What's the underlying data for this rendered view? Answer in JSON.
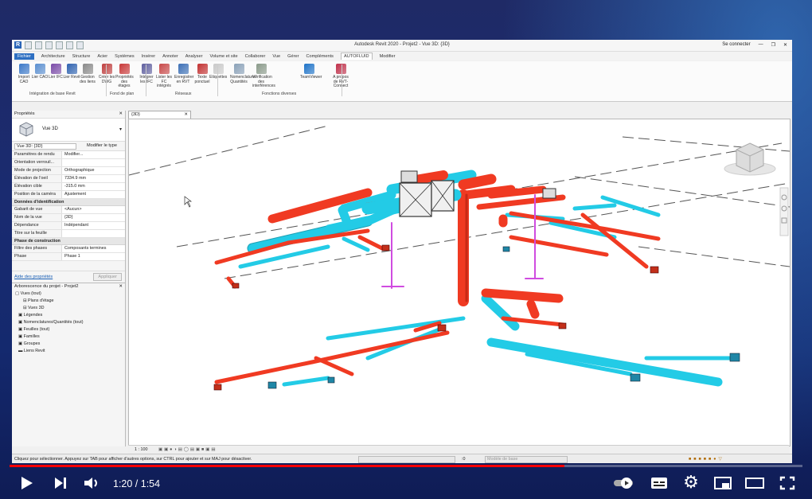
{
  "revit": {
    "window_title": "Autodesk Revit 2020 - Projet2 - Vue 3D: {3D}",
    "sign_in": "Se connecter",
    "tabs": [
      "Fichier",
      "Architecture",
      "Structure",
      "Acier",
      "Systèmes",
      "Insérer",
      "Annoter",
      "Analyser",
      "Volume et site",
      "Collaborer",
      "Vue",
      "Gérer",
      "Compléments",
      "AUTOFLUID",
      "Modifier"
    ],
    "ribbon": {
      "buttons": [
        {
          "label": "Import CAO",
          "color": "#3a78c8"
        },
        {
          "label": "Lier CAO",
          "color": "#5a8fd0"
        },
        {
          "label": "Lier IFC",
          "color": "#7a4aa8"
        },
        {
          "label": "Lier Revit",
          "color": "#2e62b0"
        },
        {
          "label": "Gestion des liens",
          "color": "#8a8a8a"
        },
        {
          "label": "Créer les DWG",
          "color": "#c04040"
        },
        {
          "label": "Propriétés des étages",
          "color": "#c83838"
        },
        {
          "label": "Intégrer les IFC",
          "color": "#5f5f9f"
        },
        {
          "label": "Lister les FC intégrés",
          "color": "#c84848"
        },
        {
          "label": "Enregistrer en RVT",
          "color": "#3b6fb6"
        },
        {
          "label": "Texte ponctuel",
          "color": "#c23030"
        },
        {
          "label": "Etiquettes",
          "color": "#c9c9c9"
        },
        {
          "label": "Nomenclature/ Quantités",
          "color": "#8aa1b8"
        },
        {
          "label": "Vérification des interférences",
          "color": "#8a9a8a"
        },
        {
          "label": "TeamViewer",
          "color": "#1e73c8"
        },
        {
          "label": "A propos de RVT-Connect",
          "color": "#c0304a"
        }
      ],
      "groups": [
        "Intégration de base Revit",
        "Fond de plan",
        "Réseaux",
        "Fonctions diverses"
      ]
    },
    "properties": {
      "header": "Propriétés",
      "type_name": "Vue 3D",
      "selector": "Vue 3D: {3D}",
      "edit_type": "Modifier le type",
      "rows": [
        {
          "k": "Paramètres de rendu",
          "v": "Modifier..."
        },
        {
          "k": "Orientation verrouil...",
          "v": ""
        },
        {
          "k": "Mode de projection",
          "v": "Orthographique"
        },
        {
          "k": "Élévation de l'oeil",
          "v": "7334.9 mm"
        },
        {
          "k": "Élévation cible",
          "v": "-315.0 mm"
        },
        {
          "k": "Position de la caméra",
          "v": "Ajustement"
        }
      ],
      "section_ident": "Données d'identification",
      "rows2": [
        {
          "k": "Gabarit de vue",
          "v": "<Aucun>"
        },
        {
          "k": "Nom de la vue",
          "v": "{3D}"
        },
        {
          "k": "Dépendance",
          "v": "Indépendant"
        },
        {
          "k": "Titre sur la feuille",
          "v": ""
        }
      ],
      "section_phase": "Phase de construction",
      "rows3": [
        {
          "k": "Filtre des phases",
          "v": "Composants termines"
        },
        {
          "k": "Phase",
          "v": "Phase 1"
        }
      ],
      "help_link": "Aide des propriétés",
      "apply": "Appliquer"
    },
    "browser": {
      "header": "Arborescence du projet - Projet2",
      "items": [
        "Vues (tout)",
        "Plans d'étage",
        "Vues 3D",
        "Légendes",
        "Nomenclatures/Quantités (tout)",
        "Feuilles (tout)",
        "Familles",
        "Groupes",
        "Liens Revit"
      ]
    },
    "view_tab": "{3D}",
    "scale": "1 : 100",
    "status_text": "Cliquez pour sélectionner. Appuyez sur TAB pour afficher d'autres options, sur CTRL pour ajouter et sur MAJ pour désactiver.",
    "status_model": "Modèle de base",
    "status_zero": ":0"
  },
  "player": {
    "time": "1:20 / 1:54",
    "progress": 0.7
  },
  "colors": {
    "supply": "#f03a22",
    "return": "#23cbe6",
    "hanger": "#d04ce0"
  }
}
